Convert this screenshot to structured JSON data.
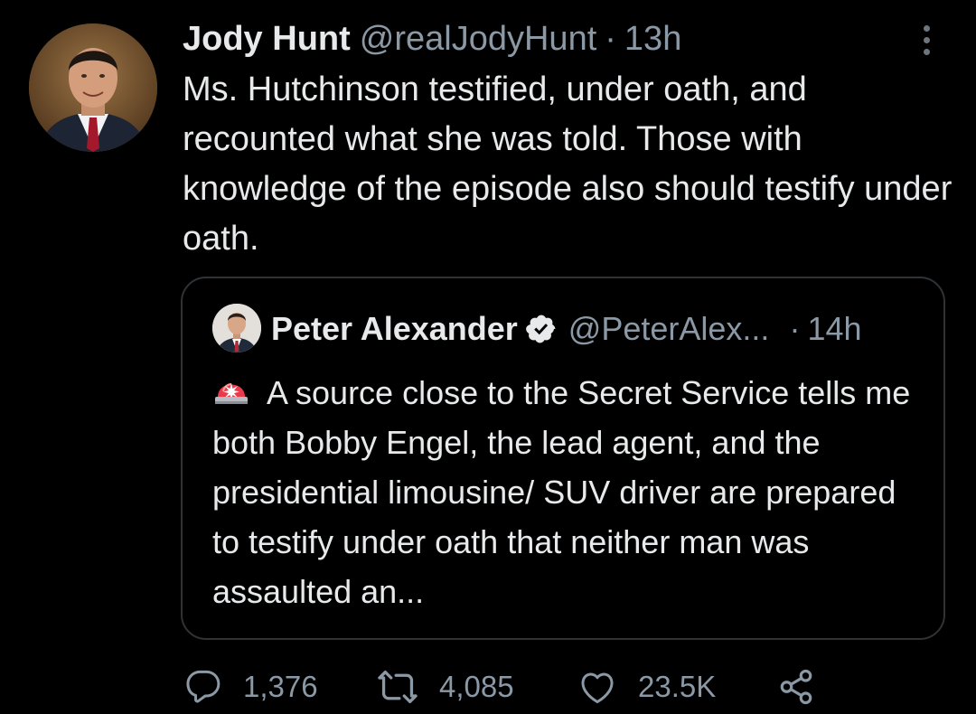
{
  "tweet": {
    "author_name": "Jody Hunt",
    "author_handle": "@realJodyHunt",
    "separator": "·",
    "time": "13h",
    "text": "Ms. Hutchinson testified, under oath, and recounted what she was told. Those with knowledge of the episode also should testify under oath."
  },
  "quote": {
    "author_name": "Peter Alexander",
    "author_handle": "@PeterAlex...",
    "separator": "·",
    "time": "14h",
    "text": "A source close to the Secret Service tells me both Bobby Engel, the lead agent, and the presidential limousine/ SUV driver are prepared to testify under oath that neither man was assaulted an..."
  },
  "actions": {
    "replies": "1,376",
    "retweets": "4,085",
    "likes": "23.5K"
  },
  "icons": {
    "more": "more-options-icon",
    "verified": "verified-badge-icon",
    "siren": "police-light-emoji",
    "reply": "reply-icon",
    "retweet": "retweet-icon",
    "like": "heart-icon",
    "share": "share-icon"
  },
  "colors": {
    "background": "#000000",
    "text_primary": "#e7e9ea",
    "text_secondary": "#8b98a5",
    "border": "#2f3336"
  }
}
